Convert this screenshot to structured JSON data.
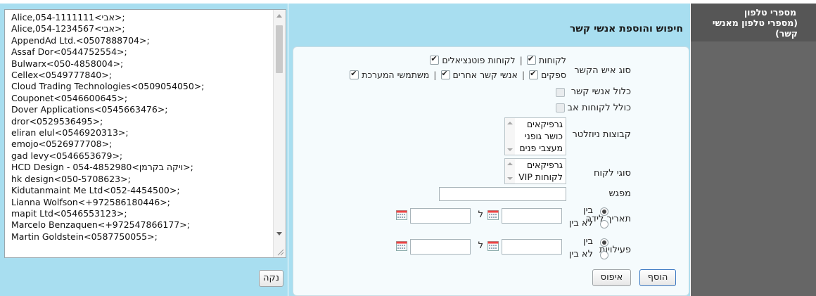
{
  "contacts_list": {
    "lines": [
      "Alice,054-1111111<אבי>;",
      "Alice,054-1234567<אבי>;",
      "AppendAd Ltd.<0507888704>;",
      "Assaf Dor<0544752554>;",
      "Bulwarx<050-4858004>;",
      "Cellex<0549777840>;",
      "Cloud Trading Technologies<0509054050>;",
      "Couponet<0546600645>;",
      "Dover Applications<0545663476>;",
      "dror<0529536495>;",
      "eliran elul<0546920313>;",
      "emojo<0526977708>;",
      "gad levy<0546653679>;",
      "HCD Design - 054-4852980<ויקה בקרמן>;",
      "hk design<050-5708623>;",
      "Kidutanmaint Me Ltd<052-4454500>;",
      "Lianna Wolfson<+972586180446>;",
      "mapit Ltd<0546553123>;",
      "Marcelo Benzaquen<+972547866177>;",
      "Martin Goldstein<0587750055>;"
    ],
    "clear_label": "נקה"
  },
  "search": {
    "title": "חיפוש והוספת אנשי קשר",
    "contact_type": {
      "label": "סוג איש הקשר",
      "options": [
        {
          "label": "לקוחות",
          "checked": true
        },
        {
          "label": "לקוחות פוטנציאלים",
          "checked": true
        },
        {
          "label": "ספקים",
          "checked": true
        },
        {
          "label": "אנשי קשר אחרים",
          "checked": true
        },
        {
          "label": "משתמשי המערכת",
          "checked": true
        }
      ]
    },
    "include_contacts": {
      "label": "כלול אנשי קשר",
      "checked": false
    },
    "include_parent_customers": {
      "label": "כולל לקוחות אב",
      "checked": false
    },
    "newsletter_groups": {
      "label": "קבוצות ניוזלטר",
      "items": [
        "גרפיקאים",
        "כושר גופני",
        "מעצבי פנים"
      ]
    },
    "customer_types": {
      "label": "סוגי לקוח",
      "items": [
        "גרפיקאים",
        "לקוחות VIP"
      ]
    },
    "meeting": {
      "label": "מפגש",
      "value": ""
    },
    "birth_date": {
      "label": "תאריך לידה",
      "range_options": [
        "בין",
        "לא בין"
      ],
      "selected": "בין",
      "to_label": "ל",
      "from": "",
      "to": ""
    },
    "activities": {
      "label": "פעילויות",
      "range_options": [
        "בין",
        "לא בין"
      ],
      "selected": "בין",
      "to_label": "ל",
      "from": "",
      "to": ""
    },
    "add_label": "הוסף",
    "reset_label": "איפוס"
  },
  "side_panel": {
    "title_line1": "מספרי טלפון",
    "title_line2": "(מספרי טלפון מאנשי קשר)"
  },
  "colors": {
    "panel_bg": "#a8def0",
    "side_bg": "#666666",
    "accent_border": "#3a78c2"
  }
}
